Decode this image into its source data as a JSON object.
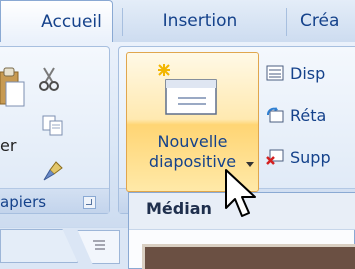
{
  "tabs": {
    "home": "Accueil",
    "insert": "Insertion",
    "design": "Créa"
  },
  "clipboard": {
    "paste_label_part": "er",
    "group_label_part": "apiers"
  },
  "slides": {
    "new_slide_line1": "Nouvelle",
    "new_slide_line2": "diapositive",
    "layout_label": "Disp",
    "reset_label": "Réta",
    "delete_label": "Supp"
  },
  "gallery": {
    "theme_name": "Médian"
  },
  "colors": {
    "tab_text": "#15428b",
    "ribbon_bg": "#dbe7f6",
    "highlight": "#ffd574",
    "thumb": "#6b5043"
  },
  "icons": [
    "paste-icon",
    "cut-icon",
    "copy-icon",
    "format-painter-icon",
    "new-slide-icon",
    "layout-icon",
    "reset-icon",
    "delete-slide-icon",
    "dialog-launcher-icon",
    "outline-icon",
    "mouse-cursor-icon"
  ]
}
